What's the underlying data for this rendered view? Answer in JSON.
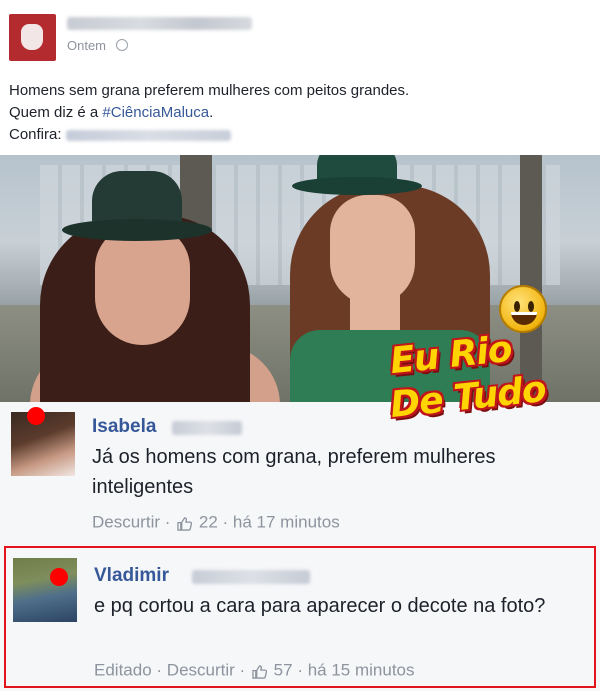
{
  "post": {
    "time": "Ontem",
    "lines": [
      "Homens sem grana preferem mulheres com peitos grandes.",
      "Quem diz é a ",
      "Confira:"
    ],
    "hashtag": "#CiênciaMaluca",
    "line2_end": "."
  },
  "watermark": {
    "line1": "Eu Rio",
    "line2": "De Tudo"
  },
  "comments": [
    {
      "author": "Isabela",
      "text": "Já os homens com grana, preferem mulheres inteligentes",
      "action": "Descurtir",
      "likes": "22",
      "time": "há 17 minutos"
    },
    {
      "author": "Vladimir",
      "text": "e pq cortou a cara para aparecer o decote na foto?",
      "edited": "Editado",
      "action": "Descurtir",
      "likes": "57",
      "time": "há 15 minutos"
    }
  ],
  "colors": {
    "link_blue": "#365899",
    "highlight_red": "#e3141b",
    "marker_red": "#ff0000"
  },
  "icons": [
    "globe-icon",
    "thumbs-up-icon",
    "smiley-icon"
  ]
}
